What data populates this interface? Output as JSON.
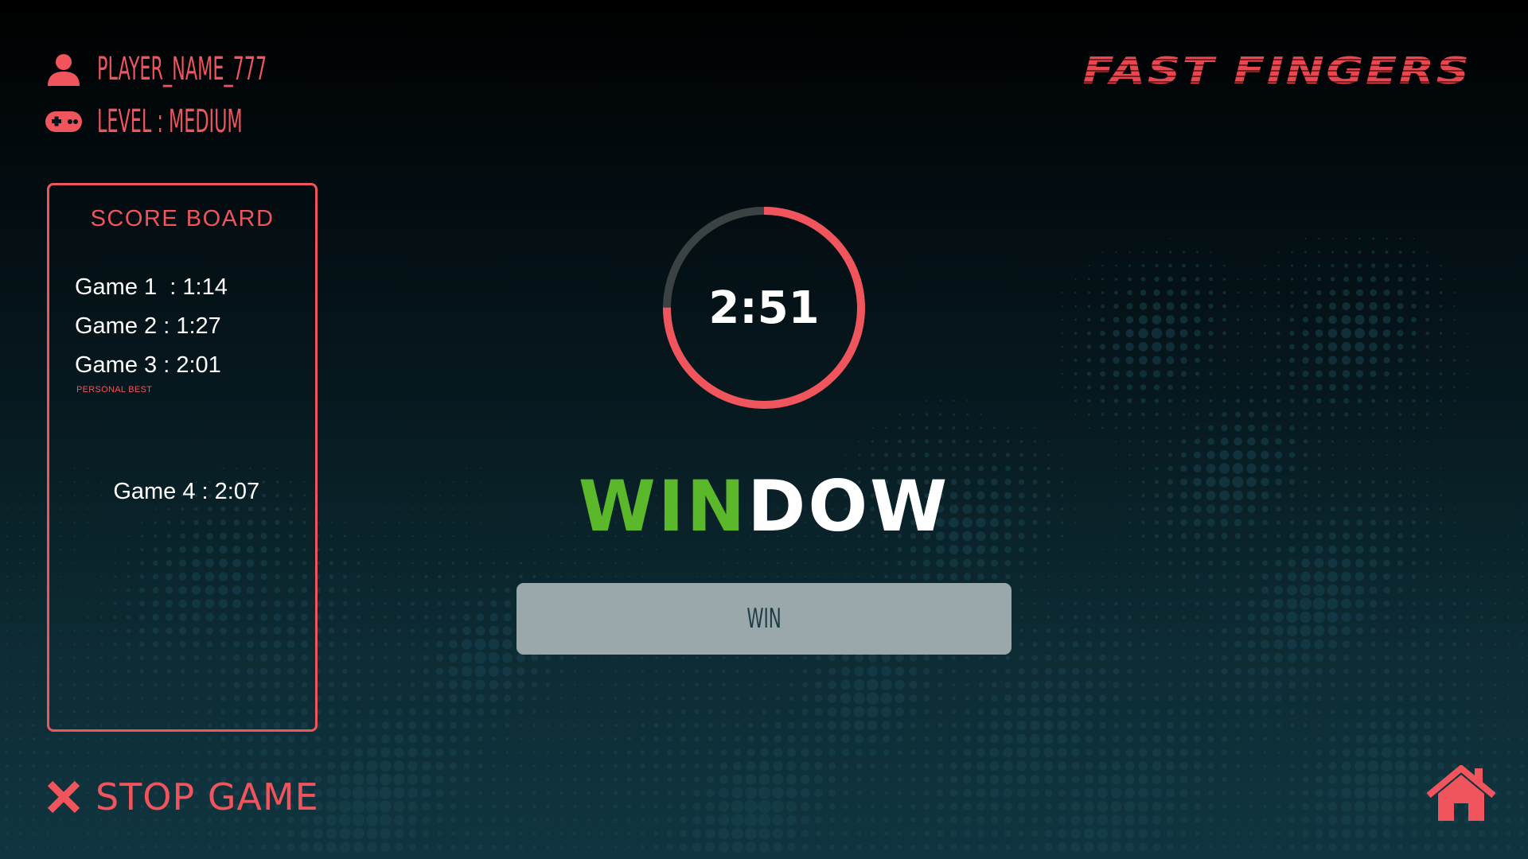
{
  "player": {
    "name": "PLAYER_NAME_777",
    "level": "LEVEL : MEDIUM",
    "name_icon": "user-icon",
    "level_icon": "gamepad-icon"
  },
  "game": {
    "title": "FAST FINGERS"
  },
  "scoreboard": {
    "title": "SCORE BOARD",
    "personal_best_label": "PERSONAL BEST",
    "entries": [
      "Game 1  : 1:14",
      "Game 2 : 1:27",
      "Game 3 : 2:01",
      "Game 4 : 2:07"
    ],
    "personal_best_index": 3
  },
  "timer": {
    "display": "2:51",
    "progress": 0.75,
    "track_color": "#3a4244",
    "progress_color": "#f0545c"
  },
  "word": {
    "typed": "WIN",
    "remaining": "DOW",
    "typed_color": "#5cb82b",
    "remaining_color": "#ffffff"
  },
  "input": {
    "value": "WIN"
  },
  "controls": {
    "stop_label": "STOP GAME",
    "stop_icon": "close-icon",
    "home_icon": "home-icon"
  },
  "colors": {
    "accent": "#f0545c",
    "success": "#5cb82b",
    "input_bg": "#9aa8ab"
  }
}
